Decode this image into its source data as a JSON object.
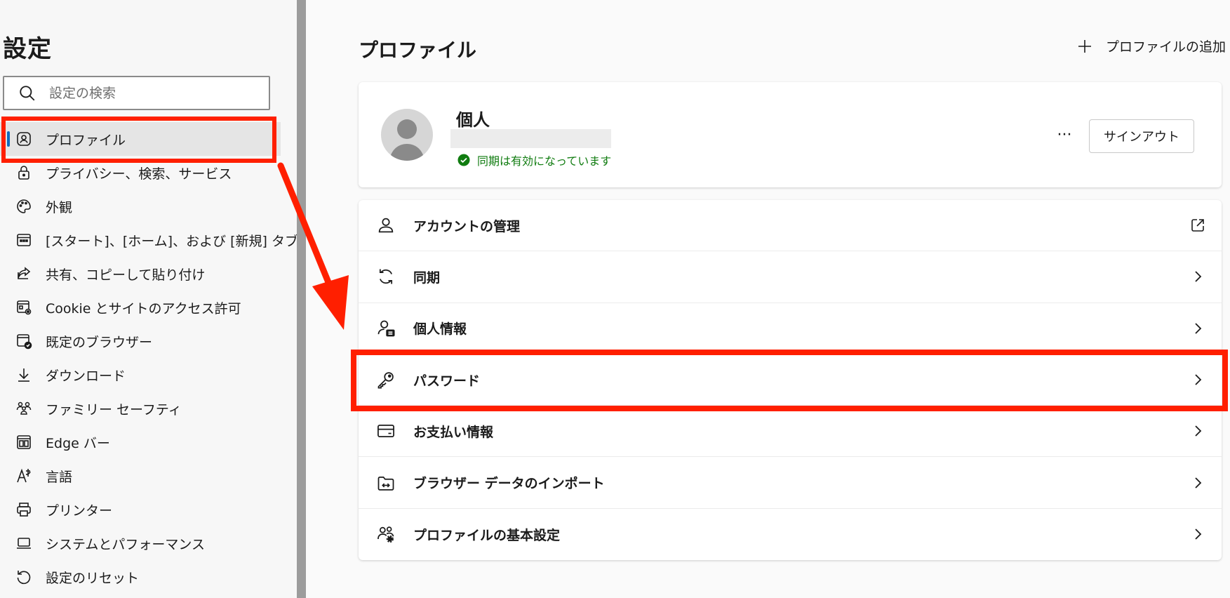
{
  "sidebar": {
    "title": "設定",
    "search": {
      "placeholder": "設定の検索",
      "value": ""
    },
    "items": [
      {
        "label": "プロファイル",
        "icon": "profile-icon",
        "active": true
      },
      {
        "label": "プライバシー、検索、サービス",
        "icon": "lock-icon"
      },
      {
        "label": "外観",
        "icon": "palette-icon"
      },
      {
        "label": "[スタート]、[ホーム]、および [新規] タブ",
        "icon": "home-tabs-icon"
      },
      {
        "label": "共有、コピーして貼り付け",
        "icon": "share-icon"
      },
      {
        "label": "Cookie とサイトのアクセス許可",
        "icon": "site-permissions-icon"
      },
      {
        "label": "既定のブラウザー",
        "icon": "default-browser-icon"
      },
      {
        "label": "ダウンロード",
        "icon": "download-icon"
      },
      {
        "label": "ファミリー セーフティ",
        "icon": "family-icon"
      },
      {
        "label": "Edge バー",
        "icon": "edge-bar-icon"
      },
      {
        "label": "言語",
        "icon": "language-icon"
      },
      {
        "label": "プリンター",
        "icon": "printer-icon"
      },
      {
        "label": "システムとパフォーマンス",
        "icon": "laptop-icon"
      },
      {
        "label": "設定のリセット",
        "icon": "reset-icon"
      }
    ]
  },
  "main": {
    "title": "プロファイル",
    "add_profile_label": "プロファイルの追加",
    "profile": {
      "name": "個人",
      "sync_status": "同期は有効になっています",
      "more_label": "···",
      "signout_label": "サインアウト"
    },
    "rows": [
      {
        "label": "アカウントの管理",
        "icon": "account-icon",
        "trail": "external-link-icon"
      },
      {
        "label": "同期",
        "icon": "sync-icon",
        "trail": "chevron-right-icon"
      },
      {
        "label": "個人情報",
        "icon": "personal-info-icon",
        "trail": "chevron-right-icon"
      },
      {
        "label": "パスワード",
        "icon": "key-icon",
        "trail": "chevron-right-icon"
      },
      {
        "label": "お支払い情報",
        "icon": "credit-card-icon",
        "trail": "chevron-right-icon"
      },
      {
        "label": "ブラウザー データのインポート",
        "icon": "import-icon",
        "trail": "chevron-right-icon"
      },
      {
        "label": "プロファイルの基本設定",
        "icon": "profile-settings-icon",
        "trail": "chevron-right-icon"
      }
    ]
  },
  "colors": {
    "highlight": "#ff1f00",
    "sync_green": "#107c10",
    "accent": "#0f6cbd"
  }
}
